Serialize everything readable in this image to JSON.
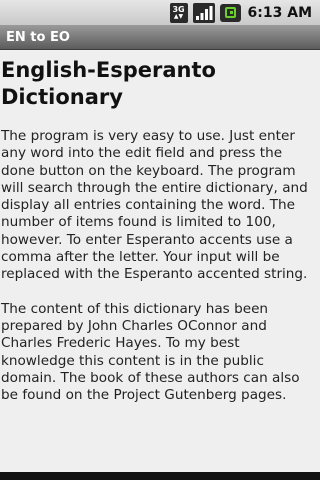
{
  "status_bar": {
    "network": "3G",
    "time": "6:13 AM"
  },
  "app": {
    "title": "EN to EO"
  },
  "main": {
    "heading": "English-Esperanto Dictionary",
    "paragraphs": [
      "The program is very easy to use. Just enter any word into the edit field and press the done button on the keyboard. The program will search through the entire dictionary, and display all entries containing the word. The number of items found is limited to 100, however. To enter Esperanto accents use a comma after the letter. Your input will be replaced with the Esperanto accented string.",
      "The content of this dictionary has been prepared by John Charles OConnor and Charles Frederic Hayes. To my best knowledge this content is in the public domain. The book of these authors can also be found on the Project Gutenberg pages."
    ]
  }
}
